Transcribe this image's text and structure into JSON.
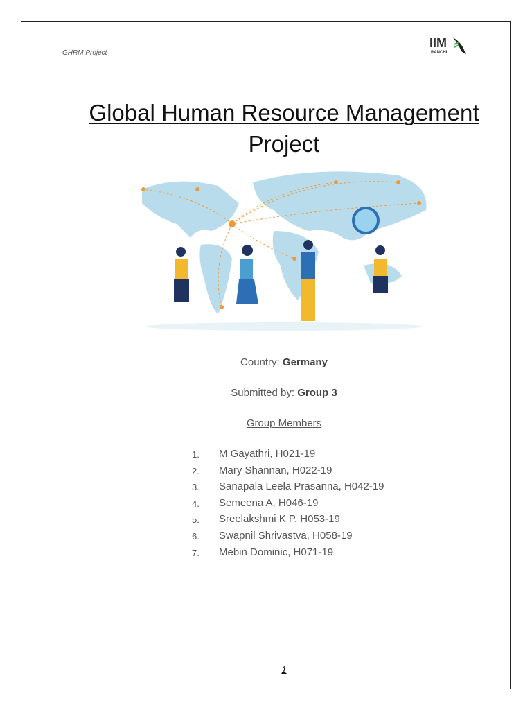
{
  "header": {
    "text": "GHRM Project",
    "logo_text": "IIM RANCHI"
  },
  "title": {
    "line1": "Global Human Resource Management",
    "line2": "Project"
  },
  "country": {
    "label": "Country:",
    "value": "Germany"
  },
  "submitted": {
    "label": "Submitted by:",
    "value": "Group 3"
  },
  "members_heading": "Group Members",
  "members": [
    {
      "num": "1.",
      "text": "M Gayathri, H021-19"
    },
    {
      "num": "2.",
      "text": "Mary Shannan, H022-19"
    },
    {
      "num": "3.",
      "text": "Sanapala Leela Prasanna, H042-19"
    },
    {
      "num": "4.",
      "text": "Semeena A, H046-19"
    },
    {
      "num": "5.",
      "text": "Sreelakshmi K P, H053-19"
    },
    {
      "num": "6.",
      "text": "Swapnil Shrivastva, H058-19"
    },
    {
      "num": "7.",
      "text": "Mebin Dominic, H071-19"
    }
  ],
  "page_number": "1"
}
